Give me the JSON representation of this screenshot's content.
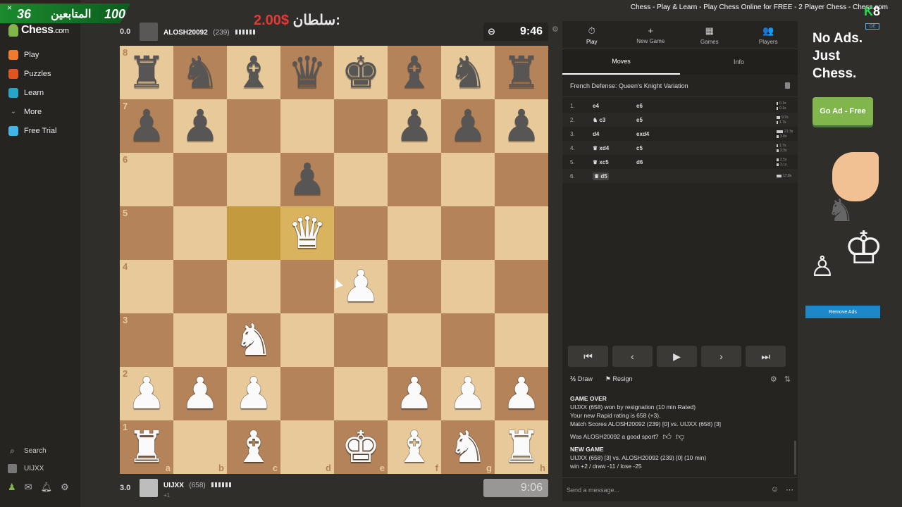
{
  "window": {
    "title": "Chess - Play & Learn - Play Chess Online for FREE - 2 Player Chess - Chess.com"
  },
  "overlay": {
    "close": "×",
    "followers_count": "36",
    "followers_label": "المتابعين",
    "goal": "100",
    "sultan_label": "سلطان:",
    "sultan_amount": "2.00$",
    "k8": "K",
    "k8_num": "8",
    "badge": "OE"
  },
  "sidebar": {
    "logo_text": "Chess",
    "logo_suffix": ".com",
    "items": [
      {
        "label": "Play",
        "color": "#ef7c2e"
      },
      {
        "label": "Puzzles",
        "color": "#e2541f"
      },
      {
        "label": "Learn",
        "color": "#26a5c9"
      },
      {
        "label": "More",
        "chevron": "⌄"
      },
      {
        "label": "Free Trial",
        "color": "#3fb8e8"
      }
    ],
    "search_label": "Search",
    "user_label": "UIJXX"
  },
  "top_player": {
    "score": "0.0",
    "name": "ALOSH20092",
    "rating": "(239)",
    "clock": "9:46"
  },
  "bottom_player": {
    "score": "3.0",
    "name": "UIJXX",
    "rating": "(658)",
    "sub": "+1",
    "clock": "9:06"
  },
  "board": {
    "files": [
      "a",
      "b",
      "c",
      "d",
      "e",
      "f",
      "g",
      "h"
    ],
    "ranks": [
      "8",
      "7",
      "6",
      "5",
      "4",
      "3",
      "2",
      "1"
    ],
    "rows": [
      [
        "bR",
        "bN",
        "bB",
        "bQ",
        "bK",
        "bB",
        "bN",
        "bR"
      ],
      [
        "bP",
        "bP",
        "",
        "",
        "",
        "bP",
        "bP",
        "bP"
      ],
      [
        "",
        "",
        "",
        "bP",
        "",
        "",
        "",
        ""
      ],
      [
        "",
        "",
        "",
        "wQ",
        "",
        "",
        "",
        ""
      ],
      [
        "",
        "",
        "",
        "",
        "wP",
        "",
        "",
        ""
      ],
      [
        "",
        "",
        "wN",
        "",
        "",
        "",
        "",
        ""
      ],
      [
        "wP",
        "wP",
        "wP",
        "",
        "",
        "wP",
        "wP",
        "wP"
      ],
      [
        "wR",
        "",
        "wB",
        "",
        "wK",
        "wB",
        "wN",
        "wR"
      ]
    ],
    "highlight": [
      "c5",
      "d5"
    ]
  },
  "panel": {
    "tabs": [
      {
        "label": "Play",
        "icon": "⏱"
      },
      {
        "label": "New Game",
        "icon": "+"
      },
      {
        "label": "Games",
        "icon": "▦"
      },
      {
        "label": "Players",
        "icon": "👥"
      }
    ],
    "subtabs": [
      "Moves",
      "Info"
    ],
    "opening": "French Defense: Queen's Knight Variation",
    "moves": [
      {
        "n": "1.",
        "w": "e4",
        "b": "e6",
        "t1": "0.1s",
        "t2": "0.1s",
        "w1": 2,
        "w2": 2
      },
      {
        "n": "2.",
        "w": "♞ c3",
        "b": "e5",
        "t1": "9.7s",
        "t2": "1.7s",
        "w1": 5,
        "w2": 2
      },
      {
        "n": "3.",
        "w": "d4",
        "b": "exd4",
        "t1": "21.3s",
        "t2": "3.8s",
        "w1": 9,
        "w2": 3
      },
      {
        "n": "4.",
        "w": "♛ xd4",
        "b": "c5",
        "t1": "1.7s",
        "t2": "2.3s",
        "w1": 2,
        "w2": 3
      },
      {
        "n": "5.",
        "w": "♛ xc5",
        "b": "d6",
        "t1": "2.5s",
        "t2": "3.1s",
        "w1": 3,
        "w2": 3
      },
      {
        "n": "6.",
        "w": "♛ d5",
        "b": "",
        "t1": "17.8s",
        "t2": "",
        "w1": 7,
        "w2": 0
      }
    ],
    "nav": [
      "⏮",
      "‹",
      "▶",
      "›",
      "⏭"
    ],
    "draw_label": "Draw",
    "resign_label": "Resign",
    "game_over": {
      "head": "GAME OVER",
      "line1": "UIJXX (658) won by resignation (10 min Rated)",
      "line2": "Your new Rapid rating is 658 (+3).",
      "line3": "Match Scores ALOSH20092 (239) [0] vs. UIJXX (658) [3]",
      "sport": "Was ALOSH20092 a good sport?",
      "new_head": "NEW GAME",
      "new_line1": "UIJXX (658) [3] vs. ALOSH20092 (239) [0] (10 min)",
      "new_line2": "win +2 / draw -11 / lose -25"
    },
    "message_placeholder": "Send a message..."
  },
  "ad": {
    "headline": "No Ads. Just Chess.",
    "button": "Go Ad - Free",
    "remove": "Remove Ads"
  }
}
